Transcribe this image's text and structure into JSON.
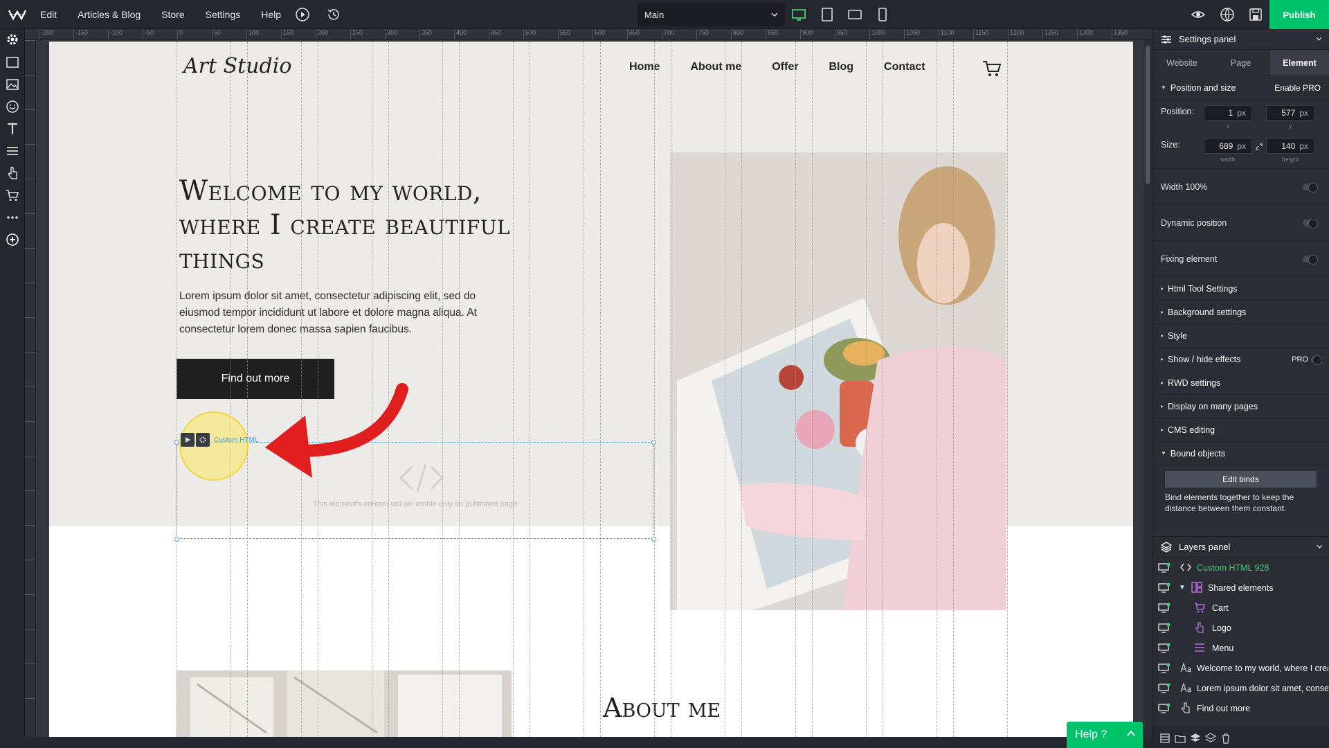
{
  "topbar": {
    "menu": [
      "Edit",
      "Articles & Blog",
      "Store",
      "Settings",
      "Help"
    ],
    "page_select": "Main",
    "publish": "Publish"
  },
  "ruler": {
    "h_ticks": [
      "-200",
      "-150",
      "-100",
      "-50",
      "0",
      "50",
      "100",
      "150",
      "200",
      "250",
      "300",
      "350",
      "400",
      "450",
      "500",
      "550",
      "600",
      "650",
      "700",
      "750",
      "800",
      "850",
      "900",
      "950",
      "1000",
      "1050",
      "1100",
      "1150",
      "1200",
      "1250",
      "1300",
      "1350"
    ]
  },
  "site": {
    "logo": "Art Studio",
    "nav": [
      "Home",
      "About me",
      "Offer",
      "Blog",
      "Contact"
    ],
    "headline": "Welcome to my world, where I create beautiful things",
    "body": "Lorem ipsum dolor sit amet, consectetur adipiscing elit, sed do eiusmod tempor incididunt ut labore et dolore magna aliqua. At consectetur lorem donec massa sapien faucibus.",
    "cta": "Find out more",
    "about_heading": "About me"
  },
  "selection": {
    "element_label": "Custom HTML",
    "note": "This element's content will we visible only on published page."
  },
  "settings_panel": {
    "title": "Settings panel",
    "tabs": [
      "Website",
      "Page",
      "Element"
    ],
    "active_tab": "Element",
    "position_size": {
      "title": "Position and size",
      "enable_pro": "Enable PRO",
      "position_label": "Position:",
      "x": "1",
      "y": "577",
      "size_label": "Size:",
      "width": "689",
      "height": "140",
      "unit": "px",
      "x_lab": "x",
      "y_lab": "y",
      "w_lab": "width",
      "h_lab": "height"
    },
    "toggles": [
      "Width 100%",
      "Dynamic position",
      "Fixing element"
    ],
    "sections": [
      "Html Tool Settings",
      "Background settings",
      "Style",
      "Show / hide effects",
      "RWD settings",
      "Display on many pages",
      "CMS editing",
      "Bound objects"
    ],
    "pro_label": "PRO",
    "edit_binds": "Edit binds",
    "bind_text": "Bind elements together to keep the distance between them constant."
  },
  "layers_panel": {
    "title": "Layers panel",
    "items": [
      {
        "name": "Custom HTML 928",
        "icon": "code-icon"
      },
      {
        "name": "Shared elements",
        "icon": "shared-elements-icon"
      },
      {
        "name": "Cart",
        "icon": "cart-icon"
      },
      {
        "name": "Logo",
        "icon": "logo-icon"
      },
      {
        "name": "Menu",
        "icon": "menu-icon"
      },
      {
        "name": "Welcome to my world, where I create",
        "icon": "text-icon"
      },
      {
        "name": "Lorem ipsum dolor sit amet, consectetur",
        "icon": "text-icon"
      },
      {
        "name": "Find out more",
        "icon": "button-icon"
      }
    ]
  },
  "help": {
    "label": "Help ?"
  },
  "colors": {
    "accent": "#00c26b",
    "selection": "#3fa0e0",
    "arrow": "#e01e1e"
  }
}
